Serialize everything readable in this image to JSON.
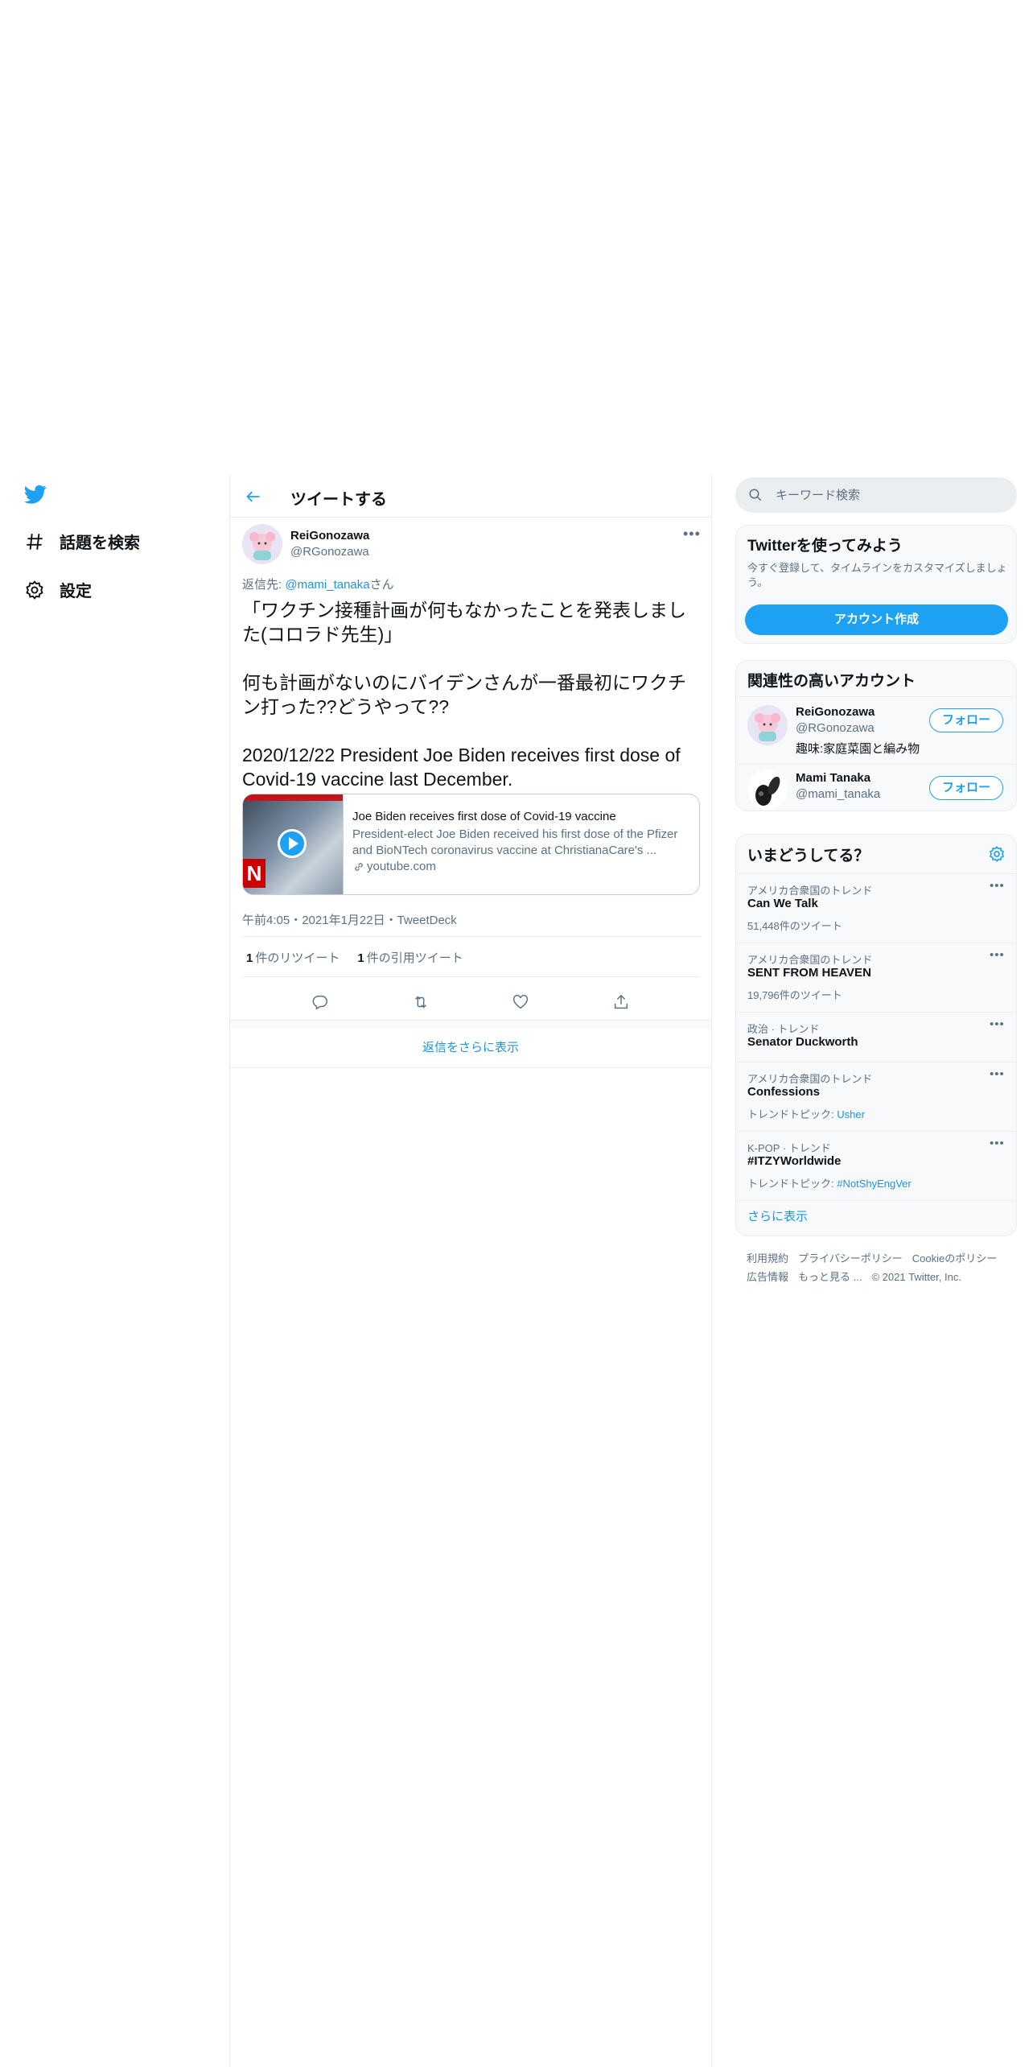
{
  "nav": {
    "logo_icon": "twitter-bird-icon",
    "explore_label": "話題を検索",
    "settings_label": "設定"
  },
  "header": {
    "title": "ツイートする"
  },
  "tweet": {
    "author_name": "ReiGonozawa",
    "author_handle": "@RGonozawa",
    "reply_prefix": "返信先: ",
    "reply_mention": "@mami_tanaka",
    "reply_suffix": "さん",
    "text": "「ワクチン接種計画が何もなかったことを発表しました(コロラド先生)」\n\n何も計画がないのにバイデンさんが一番最初にワクチン打った??どうやって??\n\n2020/12/22 President Joe Biden receives first dose of Covid-19 vaccine last December.",
    "card": {
      "title": "Joe Biden receives first dose of Covid-19 vaccine",
      "description": "President-elect Joe Biden received his first dose of the Pfizer and BioNTech coronavirus vaccine at ChristianaCare's ...",
      "domain": "youtube.com"
    },
    "meta": "午前4:05・2021年1月22日・TweetDeck",
    "retweets_count": "1",
    "retweets_label": "件のリツイート",
    "quotes_count": "1",
    "quotes_label": "件の引用ツイート"
  },
  "show_more_replies": "返信をさらに表示",
  "search": {
    "placeholder": "キーワード検索"
  },
  "signup": {
    "title": "Twitterを使ってみよう",
    "description": "今すぐ登録して、タイムラインをカスタマイズしましょう。",
    "button": "アカウント作成"
  },
  "who_to_follow": {
    "title": "関連性の高いアカウント",
    "accounts": [
      {
        "name": "ReiGonozawa",
        "handle": "@RGonozawa",
        "bio": "趣味:家庭菜園と編み物",
        "button": "フォロー"
      },
      {
        "name": "Mami Tanaka",
        "handle": "@mami_tanaka",
        "bio": "",
        "button": "フォロー"
      }
    ]
  },
  "trends": {
    "title": "いまどうしてる？",
    "items": [
      {
        "context": "アメリカ合衆国のトレンド",
        "name": "Can We Talk",
        "sub": "51,448件のツイート",
        "topic": ""
      },
      {
        "context": "アメリカ合衆国のトレンド",
        "name": "SENT FROM HEAVEN",
        "sub": "19,796件のツイート",
        "topic": ""
      },
      {
        "context": "政治 · トレンド",
        "name": "Senator Duckworth",
        "sub": "",
        "topic": ""
      },
      {
        "context": "アメリカ合衆国のトレンド",
        "name": "Confessions",
        "sub": "トレンドトピック: ",
        "topic": "Usher"
      },
      {
        "context": "K-POP · トレンド",
        "name": "#ITZYWorldwide",
        "sub": "トレンドトピック: ",
        "topic": "#NotShyEngVer"
      }
    ],
    "show_more": "さらに表示"
  },
  "footer": {
    "terms": "利用規約",
    "privacy": "プライバシーポリシー",
    "cookies": "Cookieのポリシー",
    "ads": "広告情報",
    "more": "もっと見る ...",
    "copyright": "© 2021 Twitter, Inc."
  },
  "colors": {
    "accent": "#1da1f2",
    "link": "#1b95e0",
    "secondary_text": "#5b7083"
  }
}
